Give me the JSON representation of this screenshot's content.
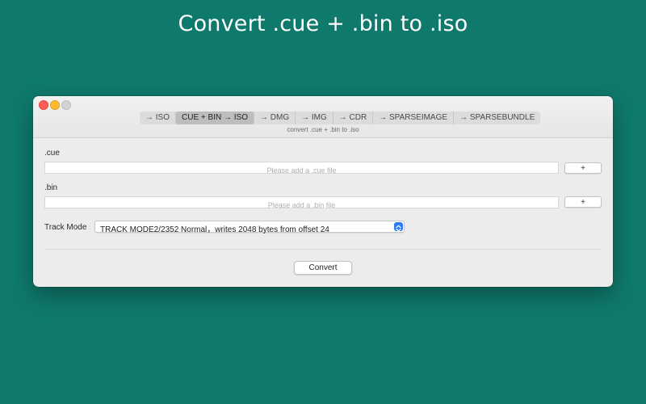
{
  "headline": "Convert .cue + .bin to .iso",
  "tabs": [
    {
      "label": "→ ISO",
      "active": false
    },
    {
      "label": "CUE + BIN → ISO",
      "active": true
    },
    {
      "label": "→ DMG",
      "active": false
    },
    {
      "label": "→ IMG",
      "active": false
    },
    {
      "label": "→ CDR",
      "active": false
    },
    {
      "label": "→ SPARSEIMAGE",
      "active": false
    },
    {
      "label": "→ SPARSEBUNDLE",
      "active": false
    }
  ],
  "subtitle": "convert .cue + .bin to .iso",
  "cue": {
    "label": ".cue",
    "placeholder": "Please add a .cue file",
    "add_label": "+"
  },
  "bin": {
    "label": ".bin",
    "placeholder": "Please add a .bin file",
    "add_label": "+"
  },
  "track_mode": {
    "label": "Track Mode",
    "selected": "TRACK MODE2/2352 Normal，writes 2048 bytes from offset 24"
  },
  "convert_label": "Convert",
  "colors": {
    "background": "#0f7a6c",
    "accent": "#2f7cf6"
  }
}
